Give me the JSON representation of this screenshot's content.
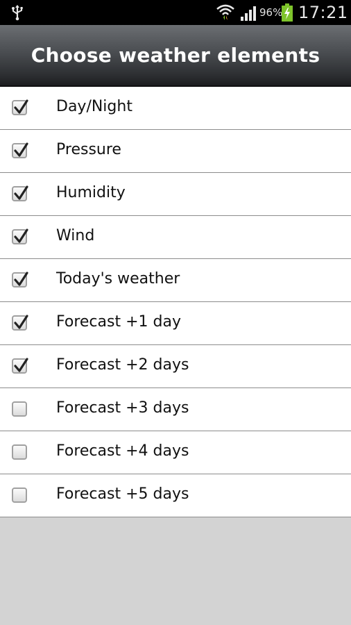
{
  "status_bar": {
    "battery_percent": "96%",
    "time": "17:21",
    "icons": [
      "usb-icon",
      "wifi-icon",
      "signal-icon",
      "battery-charging-icon"
    ]
  },
  "header": {
    "title": "Choose weather elements"
  },
  "options": [
    {
      "label": "Day/Night",
      "checked": true
    },
    {
      "label": "Pressure",
      "checked": true
    },
    {
      "label": "Humidity",
      "checked": true
    },
    {
      "label": "Wind",
      "checked": true
    },
    {
      "label": "Today's weather",
      "checked": true
    },
    {
      "label": "Forecast +1 day",
      "checked": true
    },
    {
      "label": "Forecast +2 days",
      "checked": true
    },
    {
      "label": "Forecast +3 days",
      "checked": false
    },
    {
      "label": "Forecast +4 days",
      "checked": false
    },
    {
      "label": "Forecast +5 days",
      "checked": false
    }
  ],
  "colors": {
    "header_gradient_top": "#6b6e72",
    "header_gradient_bottom": "#1c1d1f",
    "list_background": "#ffffff",
    "empty_background": "#d3d3d3",
    "battery_green": "#7ec42b"
  }
}
